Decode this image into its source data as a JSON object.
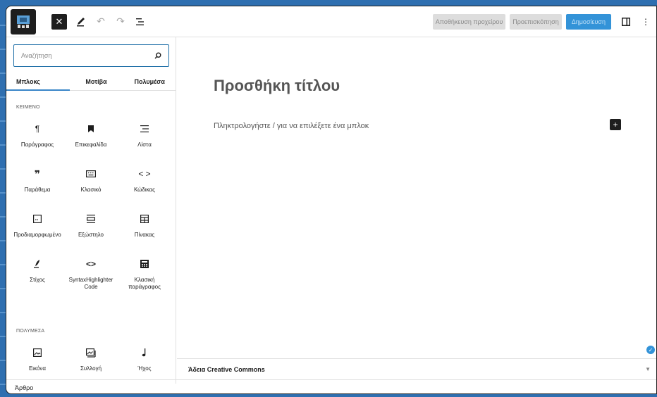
{
  "header": {
    "save_draft": "Αποθήκευση προχείρου",
    "preview": "Προεπισκόπηση",
    "publish": "Δημοσίευση",
    "accent": "#3393d8"
  },
  "inserter": {
    "search_placeholder": "Αναζήτηση",
    "tabs": [
      "Μπλοκς",
      "Μοτίβα",
      "Πολυμέσα"
    ],
    "sections": [
      {
        "title": "ΚΕΙΜΕΝΟ",
        "blocks": [
          {
            "label": "Παράγραφος",
            "icon": "paragraph-icon"
          },
          {
            "label": "Επικεφαλίδα",
            "icon": "heading-icon"
          },
          {
            "label": "Λίστα",
            "icon": "list-icon"
          },
          {
            "label": "Παράθεμα",
            "icon": "quote-icon"
          },
          {
            "label": "Κλασικό",
            "icon": "keyboard-icon"
          },
          {
            "label": "Κώδικας",
            "icon": "code-icon"
          },
          {
            "label": "Προδιαμορφωμένο",
            "icon": "preformatted-icon"
          },
          {
            "label": "Εξώστηλο",
            "icon": "pullquote-icon"
          },
          {
            "label": "Πίνακας",
            "icon": "table-icon"
          },
          {
            "label": "Στίχος",
            "icon": "verse-icon"
          },
          {
            "label": "SyntaxHighlighter Code",
            "icon": "code-icon"
          },
          {
            "label": "Κλασική παράγραφος",
            "icon": "classic-paragraph-icon"
          }
        ]
      },
      {
        "title": "ΠΟΛΥΜΕΣΑ",
        "blocks": [
          {
            "label": "Εικόνα",
            "icon": "image-icon"
          },
          {
            "label": "Συλλογή",
            "icon": "gallery-icon"
          },
          {
            "label": "Ήχος",
            "icon": "audio-icon"
          }
        ]
      }
    ]
  },
  "editor": {
    "title_placeholder": "Προσθήκη τίτλου",
    "paragraph_placeholder": "Πληκτρολογήστε / για να επιλέξετε ένα μπλοκ"
  },
  "meta_panel": {
    "title": "Άδεια Creative Commons"
  },
  "footer": {
    "breadcrumb": "Άρθρο"
  }
}
